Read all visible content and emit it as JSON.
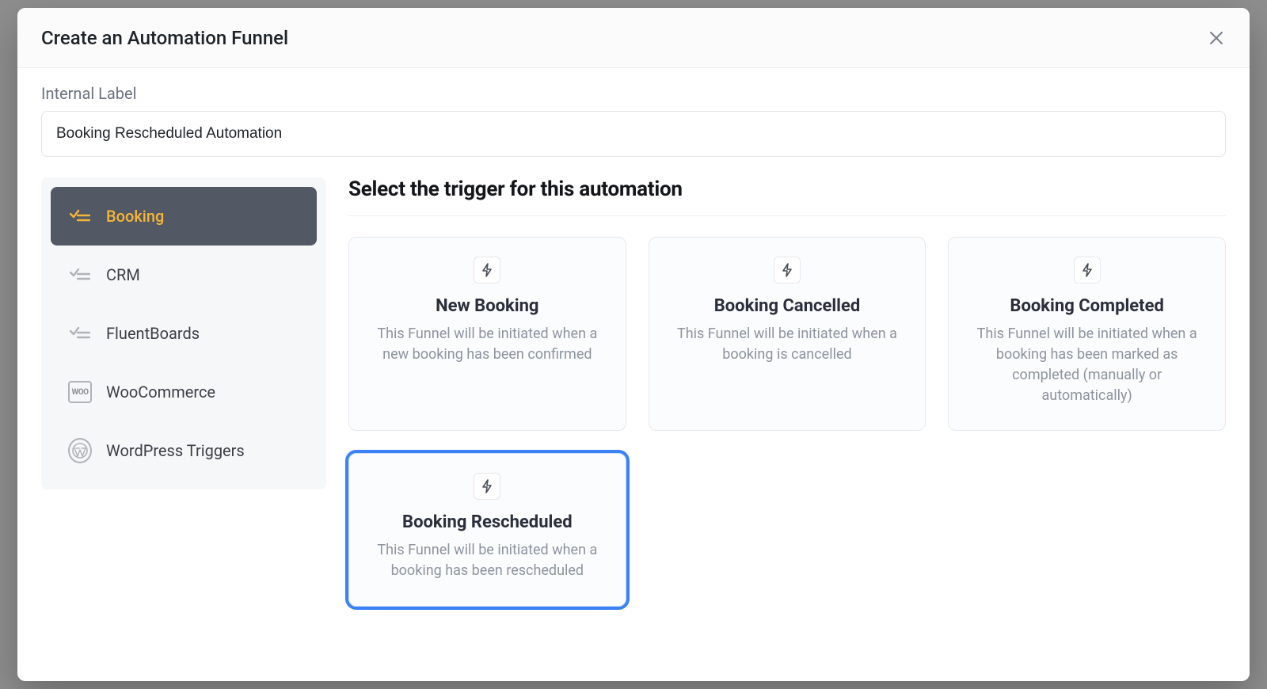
{
  "modal": {
    "title": "Create an Automation Funnel",
    "internal_label_caption": "Internal Label",
    "internal_label_value": "Booking Rescheduled Automation",
    "section_title": "Select the trigger for this automation"
  },
  "sidebar": {
    "items": [
      {
        "label": "Booking",
        "icon": "checklist-icon",
        "active": true
      },
      {
        "label": "CRM",
        "icon": "checklist-icon",
        "active": false
      },
      {
        "label": "FluentBoards",
        "icon": "checklist-icon",
        "active": false
      },
      {
        "label": "WooCommerce",
        "icon": "woo-icon",
        "active": false
      },
      {
        "label": "WordPress Triggers",
        "icon": "wordpress-icon",
        "active": false
      }
    ]
  },
  "triggers": [
    {
      "title": "New Booking",
      "description": "This Funnel will be initiated when a new booking has been confirmed",
      "selected": false
    },
    {
      "title": "Booking Cancelled",
      "description": "This Funnel will be initiated when a booking is cancelled",
      "selected": false
    },
    {
      "title": "Booking Completed",
      "description": "This Funnel will be initiated when a booking has been marked as completed (manually or automatically)",
      "selected": false
    },
    {
      "title": "Booking Rescheduled",
      "description": "This Funnel will be initiated when a booking has been rescheduled",
      "selected": true
    }
  ]
}
